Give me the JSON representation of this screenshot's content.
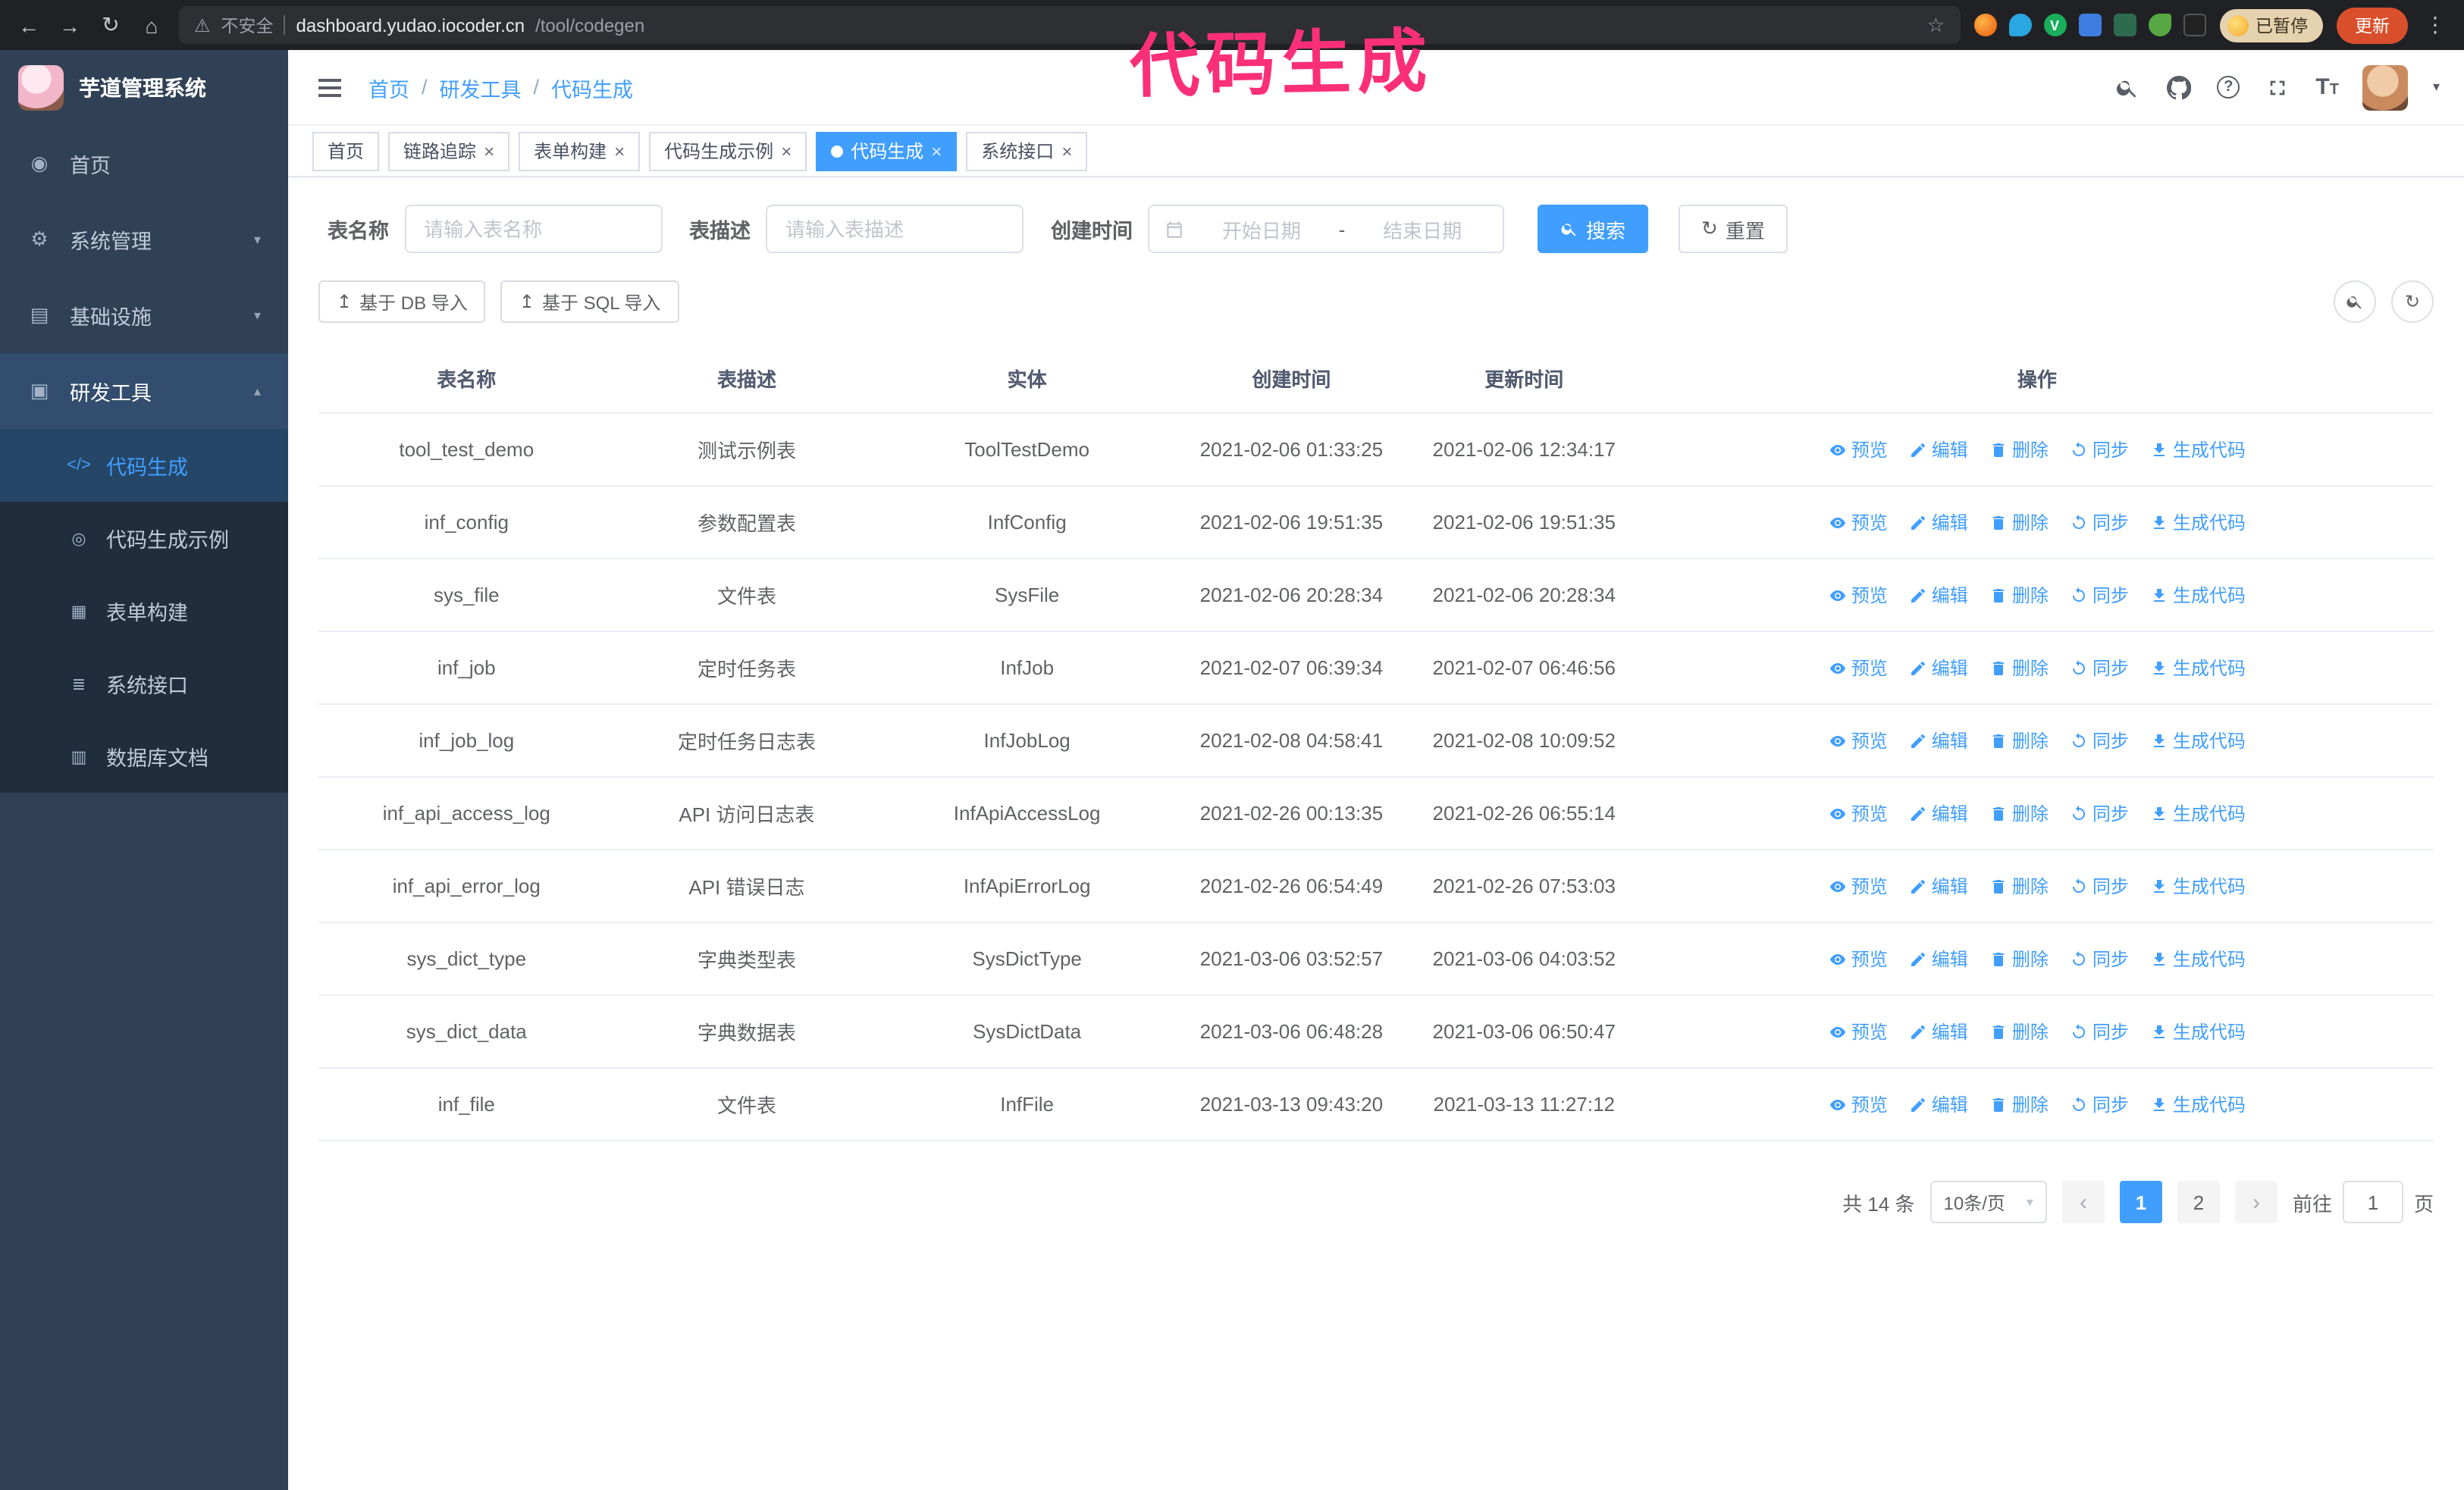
{
  "annotation": {
    "text": "代码生成"
  },
  "browser": {
    "security": "不安全",
    "url_host": "dashboard.yudao.iocoder.cn",
    "url_path": "/tool/codegen",
    "paused_badge": "已暂停",
    "update_button": "更新"
  },
  "icons": {
    "back": "←",
    "forward": "→",
    "reload": "↻",
    "home": "⌂",
    "warning": "⚠",
    "star": "☆",
    "kebab": "⋮",
    "close": "×",
    "caret_down": "▾",
    "chevron_down": "▾",
    "chevron_up": "▴",
    "prev": "‹",
    "next": "›",
    "upload": "↥",
    "sync": "↻",
    "dashboard": "◉",
    "gear": "⚙",
    "infrastructure": "▤",
    "tools": "▣",
    "code": "</>",
    "example": "◎",
    "form": "▦",
    "api": "≣",
    "dbdoc": "▥",
    "question": "?",
    "font_large": "T",
    "font_small": "T"
  },
  "sidebar": {
    "logo_title": "芋道管理系统",
    "items": [
      {
        "label": "首页"
      },
      {
        "label": "系统管理"
      },
      {
        "label": "基础设施"
      },
      {
        "label": "研发工具"
      }
    ],
    "sub_items": [
      {
        "label": "代码生成"
      },
      {
        "label": "代码生成示例"
      },
      {
        "label": "表单构建"
      },
      {
        "label": "系统接口"
      },
      {
        "label": "数据库文档"
      }
    ]
  },
  "header": {
    "breadcrumb": [
      "首页",
      "研发工具",
      "代码生成"
    ],
    "breadcrumb_separator": "/"
  },
  "tabs": [
    {
      "label": "首页",
      "closable": false,
      "active": false
    },
    {
      "label": "链路追踪",
      "closable": true,
      "active": false
    },
    {
      "label": "表单构建",
      "closable": true,
      "active": false
    },
    {
      "label": "代码生成示例",
      "closable": true,
      "active": false
    },
    {
      "label": "代码生成",
      "closable": true,
      "active": true
    },
    {
      "label": "系统接口",
      "closable": true,
      "active": false
    }
  ],
  "filters": {
    "table_name_label": "表名称",
    "table_name_placeholder": "请输入表名称",
    "table_desc_label": "表描述",
    "table_desc_placeholder": "请输入表描述",
    "create_time_label": "创建时间",
    "date_start_placeholder": "开始日期",
    "date_separator": "-",
    "date_end_placeholder": "结束日期",
    "search_button": "搜索",
    "reset_button": "重置"
  },
  "toolbar": {
    "import_db": "基于 DB 导入",
    "import_sql": "基于 SQL 导入"
  },
  "table": {
    "columns": [
      "表名称",
      "表描述",
      "实体",
      "创建时间",
      "更新时间",
      "操作"
    ],
    "actions": [
      "预览",
      "编辑",
      "删除",
      "同步",
      "生成代码"
    ],
    "rows": [
      {
        "name": "tool_test_demo",
        "desc": "测试示例表",
        "entity": "ToolTestDemo",
        "created": "2021-02-06 01:33:25",
        "updated": "2021-02-06 12:34:17"
      },
      {
        "name": "inf_config",
        "desc": "参数配置表",
        "entity": "InfConfig",
        "created": "2021-02-06 19:51:35",
        "updated": "2021-02-06 19:51:35"
      },
      {
        "name": "sys_file",
        "desc": "文件表",
        "entity": "SysFile",
        "created": "2021-02-06 20:28:34",
        "updated": "2021-02-06 20:28:34"
      },
      {
        "name": "inf_job",
        "desc": "定时任务表",
        "entity": "InfJob",
        "created": "2021-02-07 06:39:34",
        "updated": "2021-02-07 06:46:56"
      },
      {
        "name": "inf_job_log",
        "desc": "定时任务日志表",
        "entity": "InfJobLog",
        "created": "2021-02-08 04:58:41",
        "updated": "2021-02-08 10:09:52"
      },
      {
        "name": "inf_api_access_log",
        "desc": "API 访问日志表",
        "entity": "InfApiAccessLog",
        "created": "2021-02-26 00:13:35",
        "updated": "2021-02-26 06:55:14"
      },
      {
        "name": "inf_api_error_log",
        "desc": "API 错误日志",
        "entity": "InfApiErrorLog",
        "created": "2021-02-26 06:54:49",
        "updated": "2021-02-26 07:53:03"
      },
      {
        "name": "sys_dict_type",
        "desc": "字典类型表",
        "entity": "SysDictType",
        "created": "2021-03-06 03:52:57",
        "updated": "2021-03-06 04:03:52"
      },
      {
        "name": "sys_dict_data",
        "desc": "字典数据表",
        "entity": "SysDictData",
        "created": "2021-03-06 06:48:28",
        "updated": "2021-03-06 06:50:47"
      },
      {
        "name": "inf_file",
        "desc": "文件表",
        "entity": "InfFile",
        "created": "2021-03-13 09:43:20",
        "updated": "2021-03-13 11:27:12"
      }
    ]
  },
  "pagination": {
    "total": "共 14 条",
    "page_size": "10条/页",
    "pages": [
      "1",
      "2"
    ],
    "goto_label": "前往",
    "goto_value": "1",
    "goto_suffix": "页"
  }
}
